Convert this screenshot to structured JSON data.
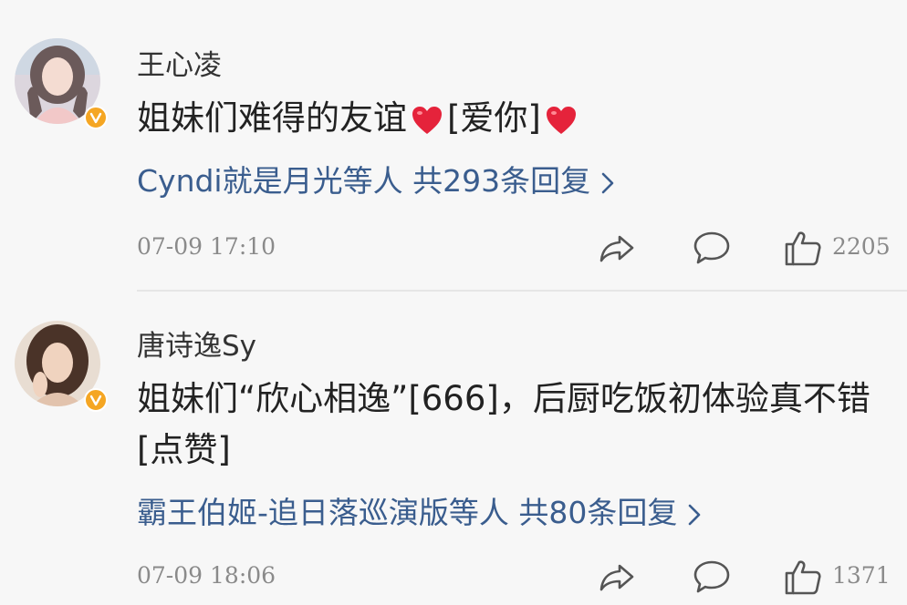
{
  "comments": [
    {
      "username": "王心凌",
      "text_before": "姐妹们难得的友谊",
      "text_middle": "[爱你]",
      "replies": "Cyndi就是月光等人 共293条回复",
      "time": "07-09 17:10",
      "likes": "2205"
    },
    {
      "username": "唐诗逸Sy",
      "text": "姐妹们“欣心相逸”[666]，后厨吃饭初体验真不错[点赞]",
      "replies": "霸王伯姬-追日落巡演版等人 共80条回复",
      "time": "07-09 18:06",
      "likes": "1371"
    }
  ],
  "icons": {
    "share": "share-icon",
    "comment": "comment-icon",
    "like": "thumbs-up-icon",
    "heart": "heart-emoji-icon",
    "verified": "verified-badge-icon",
    "chevron": "chevron-right-icon"
  },
  "colors": {
    "reply_link": "#3a5d8e",
    "badge": "#f5a623",
    "heart": "#e5233b"
  }
}
